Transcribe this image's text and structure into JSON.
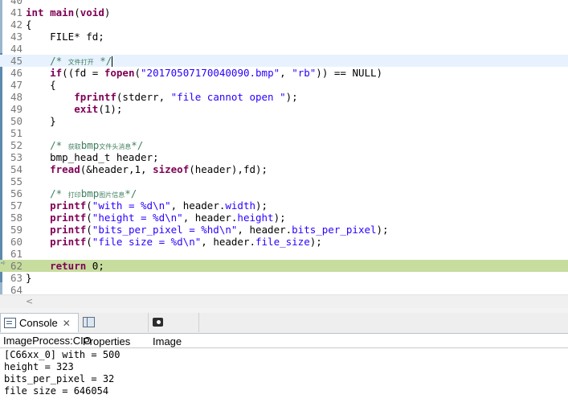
{
  "editor": {
    "lines": [
      {
        "num": "40",
        "code": []
      },
      {
        "num": "41",
        "code": [
          {
            "t": "int main",
            "c": "kw"
          },
          {
            "t": "(",
            "c": ""
          },
          {
            "t": "void",
            "c": "kw"
          },
          {
            "t": ")",
            "c": ""
          }
        ]
      },
      {
        "num": "42",
        "code": [
          {
            "t": "{",
            "c": ""
          }
        ]
      },
      {
        "num": "43",
        "code": [
          {
            "t": "    FILE* fd;",
            "c": ""
          }
        ]
      },
      {
        "num": "44",
        "code": []
      },
      {
        "num": "45",
        "current": true,
        "caret": true,
        "code": [
          {
            "t": "    /* ",
            "c": "cm"
          },
          {
            "t": "文件打开",
            "c": "cm cjk"
          },
          {
            "t": " */",
            "c": "cm"
          }
        ]
      },
      {
        "num": "46",
        "code": [
          {
            "t": "    ",
            "c": ""
          },
          {
            "t": "if",
            "c": "kw"
          },
          {
            "t": "((fd = ",
            "c": ""
          },
          {
            "t": "fopen",
            "c": "kw"
          },
          {
            "t": "(",
            "c": ""
          },
          {
            "t": "\"20170507170040090.bmp\"",
            "c": "str"
          },
          {
            "t": ", ",
            "c": ""
          },
          {
            "t": "\"rb\"",
            "c": "str"
          },
          {
            "t": ")) == NULL)",
            "c": ""
          }
        ]
      },
      {
        "num": "47",
        "code": [
          {
            "t": "    {",
            "c": ""
          }
        ]
      },
      {
        "num": "48",
        "code": [
          {
            "t": "        ",
            "c": ""
          },
          {
            "t": "fprintf",
            "c": "kw"
          },
          {
            "t": "(stderr, ",
            "c": ""
          },
          {
            "t": "\"file cannot open \"",
            "c": "str"
          },
          {
            "t": ");",
            "c": ""
          }
        ]
      },
      {
        "num": "49",
        "code": [
          {
            "t": "        ",
            "c": ""
          },
          {
            "t": "exit",
            "c": "kw"
          },
          {
            "t": "(1);",
            "c": ""
          }
        ]
      },
      {
        "num": "50",
        "code": [
          {
            "t": "    }",
            "c": ""
          }
        ]
      },
      {
        "num": "51",
        "code": []
      },
      {
        "num": "52",
        "code": [
          {
            "t": "    /* ",
            "c": "cm"
          },
          {
            "t": "获取",
            "c": "cm cjk"
          },
          {
            "t": "bmp",
            "c": "cm"
          },
          {
            "t": "文件头消息",
            "c": "cm cjk"
          },
          {
            "t": "*/",
            "c": "cm"
          }
        ]
      },
      {
        "num": "53",
        "code": [
          {
            "t": "    bmp_head_t header;",
            "c": ""
          }
        ]
      },
      {
        "num": "54",
        "code": [
          {
            "t": "    ",
            "c": ""
          },
          {
            "t": "fread",
            "c": "kw"
          },
          {
            "t": "(&header,1, ",
            "c": ""
          },
          {
            "t": "sizeof",
            "c": "kw"
          },
          {
            "t": "(header),fd);",
            "c": ""
          }
        ]
      },
      {
        "num": "55",
        "code": []
      },
      {
        "num": "56",
        "code": [
          {
            "t": "    /* ",
            "c": "cm"
          },
          {
            "t": "打印",
            "c": "cm cjk"
          },
          {
            "t": "bmp",
            "c": "cm"
          },
          {
            "t": "图片信息",
            "c": "cm cjk"
          },
          {
            "t": "*/",
            "c": "cm"
          }
        ]
      },
      {
        "num": "57",
        "code": [
          {
            "t": "    ",
            "c": ""
          },
          {
            "t": "printf",
            "c": "kw"
          },
          {
            "t": "(",
            "c": ""
          },
          {
            "t": "\"with = %d\\n\"",
            "c": "str"
          },
          {
            "t": ", header.",
            "c": ""
          },
          {
            "t": "width",
            "c": "str"
          },
          {
            "t": ");",
            "c": ""
          }
        ]
      },
      {
        "num": "58",
        "code": [
          {
            "t": "    ",
            "c": ""
          },
          {
            "t": "printf",
            "c": "kw"
          },
          {
            "t": "(",
            "c": ""
          },
          {
            "t": "\"height = %d\\n\"",
            "c": "str"
          },
          {
            "t": ", header.",
            "c": ""
          },
          {
            "t": "height",
            "c": "str"
          },
          {
            "t": ");",
            "c": ""
          }
        ]
      },
      {
        "num": "59",
        "code": [
          {
            "t": "    ",
            "c": ""
          },
          {
            "t": "printf",
            "c": "kw"
          },
          {
            "t": "(",
            "c": ""
          },
          {
            "t": "\"bits_per_pixel = %hd\\n\"",
            "c": "str"
          },
          {
            "t": ", header.",
            "c": ""
          },
          {
            "t": "bits_per_pixel",
            "c": "str"
          },
          {
            "t": ");",
            "c": ""
          }
        ]
      },
      {
        "num": "60",
        "code": [
          {
            "t": "    ",
            "c": ""
          },
          {
            "t": "printf",
            "c": "kw"
          },
          {
            "t": "(",
            "c": ""
          },
          {
            "t": "\"file size = %d\\n\"",
            "c": "str"
          },
          {
            "t": ", header.",
            "c": ""
          },
          {
            "t": "file_size",
            "c": "str"
          },
          {
            "t": ");",
            "c": ""
          }
        ]
      },
      {
        "num": "61",
        "code": []
      },
      {
        "num": "62",
        "highlight": true,
        "code": [
          {
            "t": "    ",
            "c": ""
          },
          {
            "t": "return",
            "c": "kw"
          },
          {
            "t": " 0;",
            "c": ""
          }
        ]
      },
      {
        "num": "63",
        "code": [
          {
            "t": "}",
            "c": ""
          }
        ]
      },
      {
        "num": "64",
        "code": []
      }
    ],
    "scroll_left_glyph": "<"
  },
  "tabs": [
    {
      "id": "console",
      "label": "Console",
      "close": "✕"
    },
    {
      "id": "properties",
      "label": "Properties"
    },
    {
      "id": "image",
      "label": "Image"
    }
  ],
  "console": {
    "title": "ImageProcess:CIO",
    "output": [
      "[C66xx_0] with = 500",
      "height = 323",
      "bits_per_pixel = 32",
      "file size = 646054"
    ]
  },
  "colors": {
    "keyword": "#7f0055",
    "comment": "#3f7f5f",
    "string": "#2a00ff",
    "current_line": "#e8f2fe",
    "highlight_line": "#c7dd9e"
  }
}
